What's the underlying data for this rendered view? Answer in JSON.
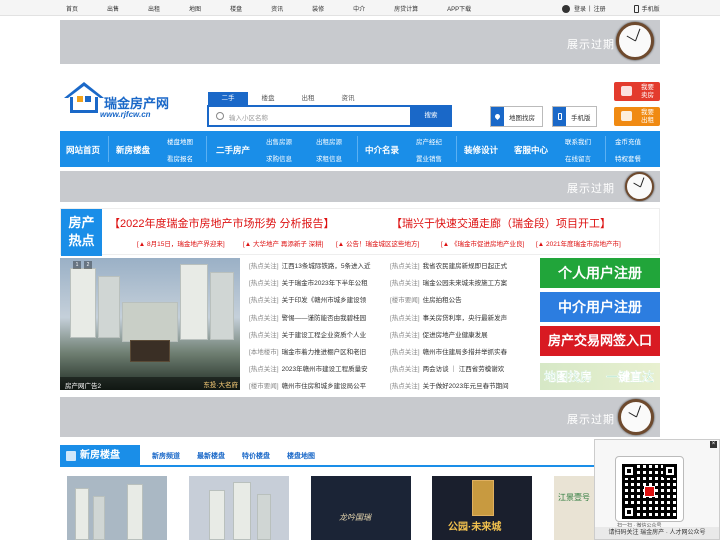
{
  "topbar": {
    "nav": [
      "首页",
      "出售",
      "出租",
      "地图",
      "楼盘",
      "资讯",
      "装修",
      "中介",
      "房贷计算",
      "APP下载"
    ],
    "login": "登录",
    "sep": "|",
    "register": "注册",
    "mobile": "手机版"
  },
  "ad_text": "展示过期",
  "logo": {
    "name": "瑞金房产网",
    "url": "www.rjfcw.cn"
  },
  "search": {
    "tabs": [
      "二手",
      "楼盘",
      "出租",
      "资讯"
    ],
    "placeholder": "输入小区名称",
    "button": "搜索"
  },
  "tools": {
    "map": "地图找房",
    "mobile": "手机版"
  },
  "right_buttons": [
    {
      "l1": "我要",
      "l2": "卖房",
      "color": "#e33b2d"
    },
    {
      "l1": "我要",
      "l2": "出租",
      "color": "#f08a12"
    }
  ],
  "mainnav": {
    "home": "网站首页",
    "newhouse": "新房楼盘",
    "loupan_map": "楼盘地图",
    "kanfang": "看房报名",
    "ershou": "二手房产",
    "chushou": "出售房源",
    "qiugou": "求购信息",
    "chuzu": "出租房源",
    "qiuzu": "求租信息",
    "zhongjie": "中介名录",
    "jingji": "房产经纪",
    "zhiye": "置业销售",
    "zhuangxiu": "装修设计",
    "kefu": "客服中心",
    "lianxi": "联系我们",
    "liuyan": "在线留言",
    "jinbi": "金币充值",
    "tequan": "特权套餐"
  },
  "hot": {
    "label1": "房产",
    "label2": "热点",
    "headline1": "【2022年度瑞金市房地产市场形势 分析报告】",
    "headline2": "【瑞兴于快速交通走廊（瑞金段）项目开工】",
    "links": [
      "[▲ 8月15日，瑞金地产界迎来]",
      "[▲ 大华地产 再添新子 深耕]",
      "[▲ 公告！瑞金城区这些地方]",
      "[▲ 《瑞金市促进房地产业良]",
      "[▲ 2021年度瑞金市房地产市]"
    ]
  },
  "carousel": {
    "caption": "房产网广告2",
    "badge": "东投·大名府",
    "dots": [
      "1",
      "2"
    ]
  },
  "news_left": [
    {
      "tag": "[热点关注]",
      "title": "江西13条城际铁路，5条进入近"
    },
    {
      "tag": "[热点关注]",
      "title": "关于瑞金市2023年下半年公租"
    },
    {
      "tag": "[热点关注]",
      "title": "关于印发《赣州市城乡建设领"
    },
    {
      "tag": "[热点关注]",
      "title": "警惕——谨防能否由我碧桂园"
    },
    {
      "tag": "[热点关注]",
      "title": "关于建设工程企业资质个人业"
    },
    {
      "tag": "[本地楼市]",
      "title": "瑞金市着力推进棚户区和老旧"
    },
    {
      "tag": "[热点关注]",
      "title": "2023年赣州市建设工程质量安"
    },
    {
      "tag": "[楼市要闻]",
      "title": "赣州市住房和城乡建设局公平"
    }
  ],
  "news_right": [
    {
      "tag": "[热点关注]",
      "title": "我省农民建房新规即日起正式"
    },
    {
      "tag": "[热点关注]",
      "title": "瑞金公园未来城未按施工方案"
    },
    {
      "tag": "[楼市要闻]",
      "title": "住房拍租公告"
    },
    {
      "tag": "[热点关注]",
      "title": "事关房贷利率，央行最新发声"
    },
    {
      "tag": "[热点关注]",
      "title": "促进房地产业健康发展"
    },
    {
      "tag": "[热点关注]",
      "title": "赣州市住建局多措并举抓实春"
    },
    {
      "tag": "[热点关注]",
      "title": "两会访谈 ｜ 江西省劳模谢欢"
    },
    {
      "tag": "[热点关注]",
      "title": "关于做好2023年元旦春节期间"
    }
  ],
  "side_buttons": [
    {
      "label": "个人用户注册",
      "color": "#21a53a"
    },
    {
      "label": "中介用户注册",
      "color": "#2c7de0"
    },
    {
      "label": "房产交易网签入口",
      "color": "#d81a22"
    }
  ],
  "map_banner": {
    "a": "地图找房",
    "b": "一键直达"
  },
  "section": {
    "title": "新房楼盘",
    "links": [
      "新房频道",
      "最新楼盘",
      "特价楼盘",
      "楼盘地图"
    ],
    "more": "更多"
  },
  "thumbs": [
    {
      "text": "",
      "bg": "#aab8c4"
    },
    {
      "text": "",
      "bg": "#c7ced8"
    },
    {
      "text": "龙吟国瑞",
      "bg": "#1b2436"
    },
    {
      "text": "公园·未来城",
      "bg": "#1a1f2d"
    },
    {
      "text": "江景壹号",
      "bg": "#e9e3d4"
    }
  ],
  "qr": {
    "close": "×",
    "footer": "请扫码关注 瑞金房产 · 人才网公众号",
    "tip": "扫一扫 · 微信公众号"
  }
}
